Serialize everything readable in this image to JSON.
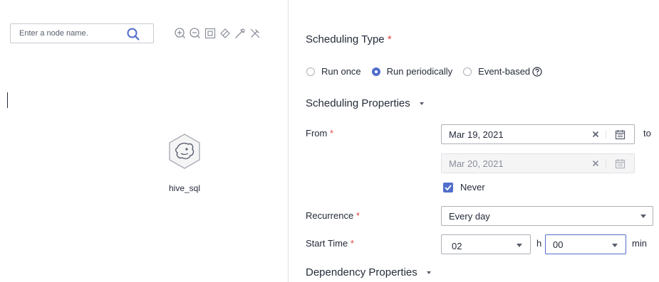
{
  "canvas": {
    "search_placeholder": "Enter a node name.",
    "node_label": "hive_sql",
    "toolbar_icons": [
      "zoom-in-icon",
      "zoom-out-icon",
      "fit-screen-icon",
      "expand-icon",
      "edit-link-icon",
      "delete-link-icon"
    ]
  },
  "scheduling": {
    "type_title": "Scheduling Type",
    "required_mark": "*",
    "options": [
      "Run once",
      "Run periodically",
      "Event-based"
    ],
    "selected_option": "Run periodically",
    "properties_title": "Scheduling Properties",
    "from_label": "From",
    "from_date": "Mar 19, 2021",
    "to_label": "to",
    "to_date": "Mar 20, 2021",
    "never_label": "Never",
    "never_checked": true,
    "recurrence_label": "Recurrence",
    "recurrence_value": "Every day",
    "start_time_label": "Start Time",
    "hour_value": "02",
    "hour_unit": "h",
    "minute_value": "00",
    "minute_unit": "min",
    "dependency_title": "Dependency Properties"
  },
  "colors": {
    "accent": "#526ecc",
    "required": "#e54545",
    "text": "#252b3a",
    "border": "#adb0b8"
  }
}
